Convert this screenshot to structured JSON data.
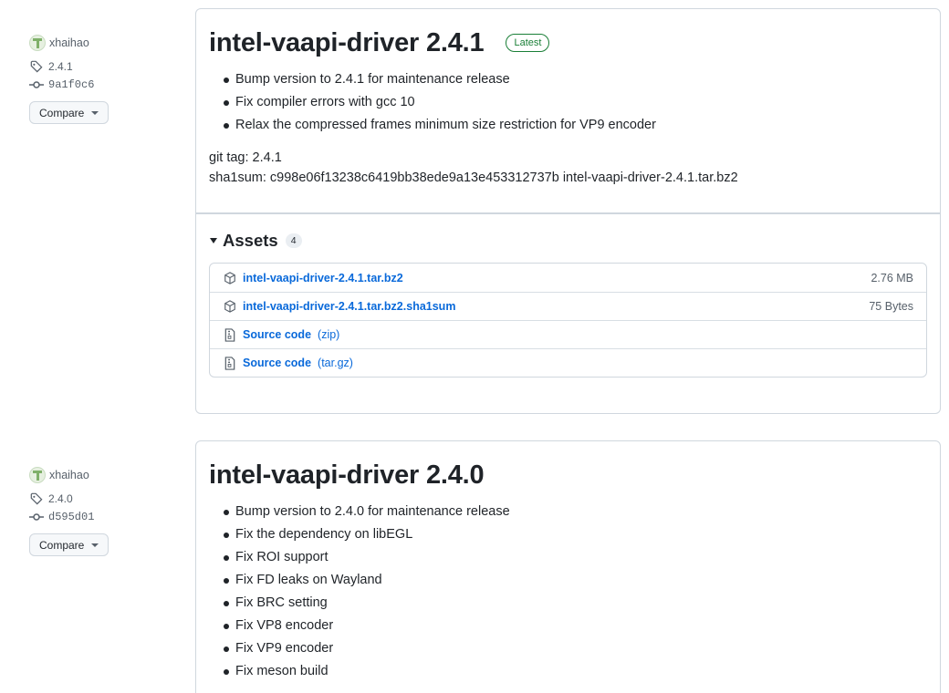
{
  "releases": [
    {
      "author": "xhaihao",
      "tag": "2.4.1",
      "commit": "9a1f0c6",
      "compare_label": "Compare",
      "title": "intel-vaapi-driver 2.4.1",
      "badge": "Latest",
      "notes": [
        "Bump version to 2.4.1 for maintenance release",
        "Fix compiler errors with gcc 10",
        "Relax the compressed frames minimum size restriction for VP9 encoder"
      ],
      "git_tag_line": "git tag: 2.4.1",
      "sha_line": "sha1sum: c998e06f13238c6419bb38ede9a13e453312737b intel-vaapi-driver-2.4.1.tar.bz2",
      "assets_label": "Assets",
      "assets_count": "4",
      "assets": [
        {
          "name": "intel-vaapi-driver-2.4.1.tar.bz2",
          "size": "2.76 MB",
          "icon": "package-icon"
        },
        {
          "name": "intel-vaapi-driver-2.4.1.tar.bz2.sha1sum",
          "size": "75 Bytes",
          "icon": "package-icon"
        },
        {
          "name": "Source code",
          "sub": "(zip)",
          "icon": "file-zip-icon"
        },
        {
          "name": "Source code",
          "sub": "(tar.gz)",
          "icon": "file-zip-icon"
        }
      ]
    },
    {
      "author": "xhaihao",
      "tag": "2.4.0",
      "commit": "d595d01",
      "compare_label": "Compare",
      "title": "intel-vaapi-driver 2.4.0",
      "notes": [
        "Bump version to 2.4.0 for maintenance release",
        "Fix the dependency on libEGL",
        "Fix ROI support",
        "Fix FD leaks on Wayland",
        "Fix BRC setting",
        "Fix VP8 encoder",
        "Fix VP9 encoder",
        "Fix meson build"
      ]
    }
  ],
  "colors": {
    "link": "#0969da",
    "latest": "#1a7f37",
    "border": "#d0d7de",
    "muted": "#57606a"
  }
}
